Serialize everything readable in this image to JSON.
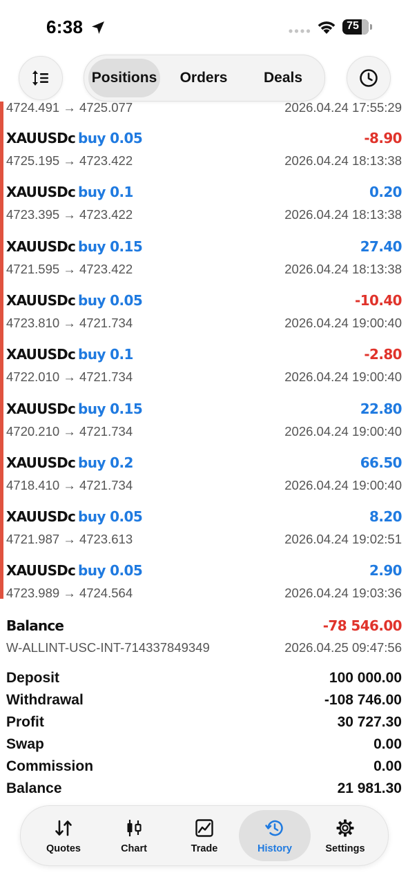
{
  "status_bar": {
    "time": "6:38",
    "battery": "75"
  },
  "segments": [
    {
      "label": "Positions",
      "active": true
    },
    {
      "label": "Orders",
      "active": false
    },
    {
      "label": "Deals",
      "active": false
    }
  ],
  "partial_row": {
    "prices": "4724.491 → 4725.077",
    "datetime": "2026.04.24 17:55:29"
  },
  "deals": [
    {
      "symbol": "XAUUSDc",
      "side": "buy 0.05",
      "profit": "-8.90",
      "prices": "4725.195 → 4723.422",
      "datetime": "2026.04.24 18:13:38"
    },
    {
      "symbol": "XAUUSDc",
      "side": "buy 0.1",
      "profit": "0.20",
      "prices": "4723.395 → 4723.422",
      "datetime": "2026.04.24 18:13:38"
    },
    {
      "symbol": "XAUUSDc",
      "side": "buy 0.15",
      "profit": "27.40",
      "prices": "4721.595 → 4723.422",
      "datetime": "2026.04.24 18:13:38"
    },
    {
      "symbol": "XAUUSDc",
      "side": "buy 0.05",
      "profit": "-10.40",
      "prices": "4723.810 → 4721.734",
      "datetime": "2026.04.24 19:00:40"
    },
    {
      "symbol": "XAUUSDc",
      "side": "buy 0.1",
      "profit": "-2.80",
      "prices": "4722.010 → 4721.734",
      "datetime": "2026.04.24 19:00:40"
    },
    {
      "symbol": "XAUUSDc",
      "side": "buy 0.15",
      "profit": "22.80",
      "prices": "4720.210 → 4721.734",
      "datetime": "2026.04.24 19:00:40"
    },
    {
      "symbol": "XAUUSDc",
      "side": "buy 0.2",
      "profit": "66.50",
      "prices": "4718.410 → 4721.734",
      "datetime": "2026.04.24 19:00:40"
    },
    {
      "symbol": "XAUUSDc",
      "side": "buy 0.05",
      "profit": "8.20",
      "prices": "4721.987 → 4723.613",
      "datetime": "2026.04.24 19:02:51"
    },
    {
      "symbol": "XAUUSDc",
      "side": "buy 0.05",
      "profit": "2.90",
      "prices": "4723.989 → 4724.564",
      "datetime": "2026.04.24 19:03:36"
    }
  ],
  "balance_entry": {
    "label": "Balance",
    "amount": "-78 546.00",
    "account": "W-ALLINT-USC-INT-714337849349",
    "datetime": "2026.04.25 09:47:56"
  },
  "summary": [
    {
      "label": "Deposit",
      "value": "100 000.00"
    },
    {
      "label": "Withdrawal",
      "value": "-108 746.00"
    },
    {
      "label": "Profit",
      "value": "30 727.30"
    },
    {
      "label": "Swap",
      "value": "0.00"
    },
    {
      "label": "Commission",
      "value": "0.00"
    },
    {
      "label": "Balance",
      "value": "21 981.30"
    }
  ],
  "tabs": [
    {
      "label": "Quotes",
      "icon": "quotes-icon",
      "active": false
    },
    {
      "label": "Chart",
      "icon": "candlestick-icon",
      "active": false
    },
    {
      "label": "Trade",
      "icon": "trade-icon",
      "active": false
    },
    {
      "label": "History",
      "icon": "history-icon",
      "active": true
    },
    {
      "label": "Settings",
      "icon": "gear-icon",
      "active": false
    }
  ],
  "colors": {
    "accent": "#1f7ae0",
    "negative": "#e0332b",
    "sidebar_marker": "#e0523f"
  }
}
